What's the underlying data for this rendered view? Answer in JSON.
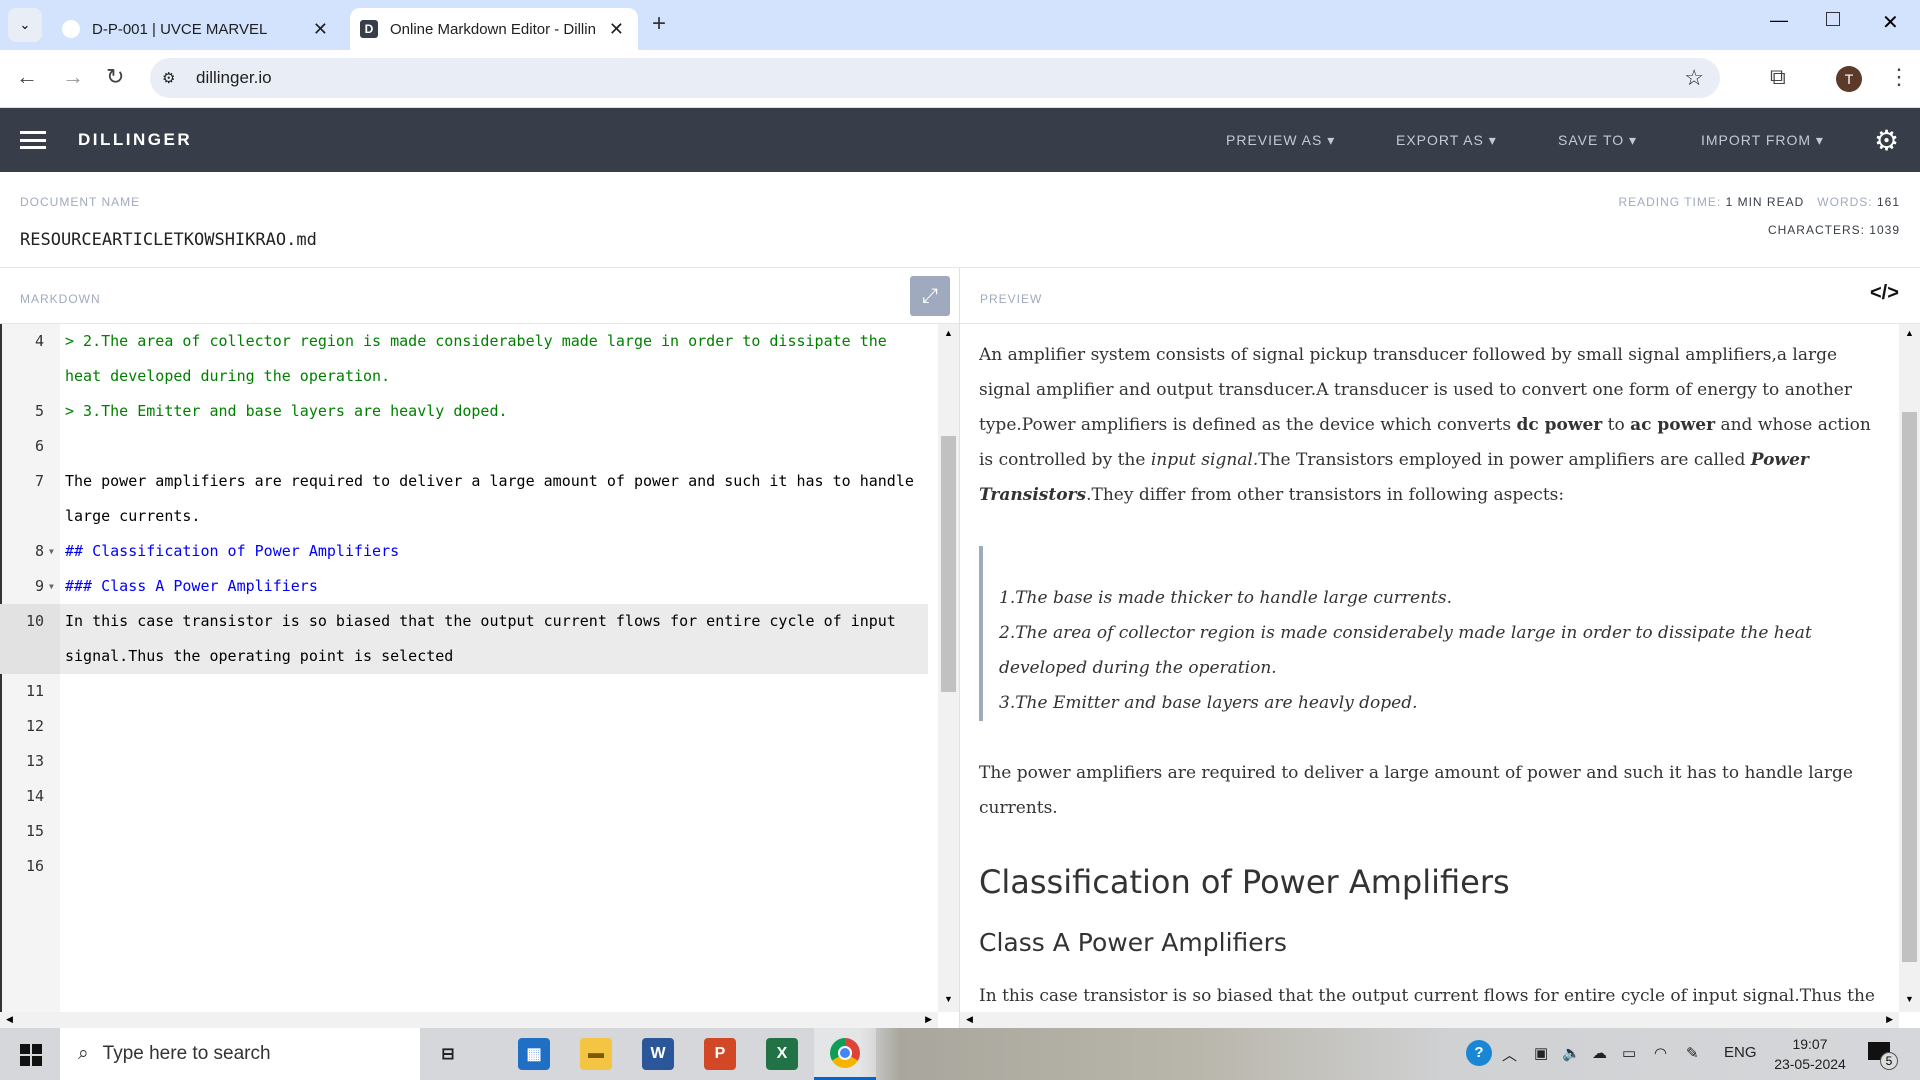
{
  "browser": {
    "tabs": [
      {
        "title": "D-P-001 | UVCE MARVEL",
        "active": false
      },
      {
        "title": "Online Markdown Editor - Dillin",
        "active": true
      }
    ],
    "url": "dillinger.io",
    "profile_initial": "T"
  },
  "app": {
    "brand": "DILLINGER",
    "menus": [
      "PREVIEW AS",
      "EXPORT AS",
      "SAVE TO",
      "IMPORT FROM"
    ]
  },
  "document": {
    "name_label": "DOCUMENT NAME",
    "name": "RESOURCEARTICLETKOWSHIKRAO.md",
    "reading_time_label": "READING TIME:",
    "reading_time": "1 MIN READ",
    "words_label": "WORDS:",
    "words": "161",
    "characters_label": "CHARACTERS:",
    "characters": "1039"
  },
  "panes": {
    "markdown_label": "MARKDOWN",
    "preview_label": "PREVIEW"
  },
  "editor": {
    "lines": [
      {
        "n": "4",
        "text": "> 2.The area of collector region is made considerabely made large in order to dissipate the heat developed during the operation.",
        "type": "quote"
      },
      {
        "n": "5",
        "text": "> 3.The Emitter and base layers are heavly doped.",
        "type": "quote"
      },
      {
        "n": "6",
        "text": "",
        "type": "text"
      },
      {
        "n": "7",
        "text": "The power amplifiers are required to deliver a large amount of power and such it has to handle large currents.",
        "type": "text"
      },
      {
        "n": "8",
        "text": "## Classification of Power Amplifiers",
        "type": "head",
        "fold": true
      },
      {
        "n": "9",
        "text": "### Class A Power Amplifiers",
        "type": "head",
        "fold": true
      },
      {
        "n": "10",
        "text": "In this case transistor is so biased that the output current flows for entire cycle of input signal.Thus the operating point is selected",
        "type": "text",
        "current": true
      },
      {
        "n": "11",
        "text": "",
        "type": "text"
      },
      {
        "n": "12",
        "text": "",
        "type": "text"
      },
      {
        "n": "13",
        "text": "",
        "type": "text"
      },
      {
        "n": "14",
        "text": "",
        "type": "text"
      },
      {
        "n": "15",
        "text": "",
        "type": "text"
      },
      {
        "n": "16",
        "text": "",
        "type": "text"
      }
    ]
  },
  "preview": {
    "p1_a": "An amplifier system consists of signal pickup transducer followed by small signal amplifiers,a large signal amplifier and output transducer.A transducer is used to convert one form of energy to another type.Power amplifiers is defined as the device which converts ",
    "p1_b1": "dc power",
    "p1_c": " to ",
    "p1_b2": "ac power",
    "p1_d": " and whose action is controlled by the ",
    "p1_i": "input signal.",
    "p1_e": "The Transistors employed in power amplifiers are called ",
    "p1_bi": "Power Transistors",
    "p1_f": ".They differ from other transistors in following aspects:",
    "quote": [
      "1.The base is made thicker to handle large currents.",
      "2.The area of collector region is made considerabely made large in order to dissipate the heat developed during the operation.",
      "3.The Emitter and base layers are heavly doped."
    ],
    "p2": "The power amplifiers are required to deliver a large amount of power and such it has to handle large currents.",
    "h2": "Classification of Power Amplifiers",
    "h3": "Class A Power Amplifiers",
    "p3": "In this case transistor is so biased that the output current flows for entire cycle of input signal.Thus the operating point is selected"
  },
  "taskbar": {
    "search_placeholder": "Type here to search",
    "language": "ENG",
    "time": "19:07",
    "date": "23-05-2024",
    "notifications": "5"
  },
  "colors": {
    "appbar": "#373d49",
    "quote": "#008000",
    "heading": "#0000ff"
  }
}
